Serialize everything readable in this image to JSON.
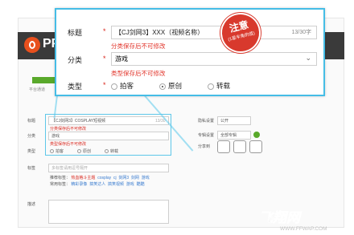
{
  "app": {
    "logo_text": "PP"
  },
  "progress": {
    "value_fraction": 0.2,
    "label": "平台通道"
  },
  "form": {
    "title_label": "标题",
    "title_value": "【CJ剑网3】COSPLAY短视频",
    "title_count": "13/30",
    "category_label": "分类",
    "category_note": "分类保存后不可修改",
    "category_value": "游戏",
    "type_label": "类型",
    "type_note": "类型保存后不可修改",
    "type_options": [
      "拍客",
      "原创",
      "转载"
    ],
    "tags_label": "标签",
    "tags_placeholder": "多标签请用逗号隔开",
    "recommended_label": "推荐标签：",
    "recommended_tags": [
      "热血格斗主题",
      "cosplay",
      "cj",
      "剑网3",
      "剑网",
      "游戏"
    ],
    "common_label": "常用标签：",
    "common_tags": [
      "精彩录像",
      "搞笑达人",
      "搞笑视频",
      "游戏",
      "酷酷"
    ],
    "desc_label": "描述"
  },
  "right_panel": {
    "privacy_label": "隐私设置",
    "privacy_value": "公开",
    "album_label": "专辑设置",
    "album_value": "全部专辑",
    "share_label": "分享到"
  },
  "popup": {
    "title_label": "标题",
    "title_value": "【CJ剑网3】XXX（视频名称）",
    "title_count": "13/30字",
    "category_note": "分类保存后不可修改",
    "category_label": "分类",
    "category_value": "游戏",
    "type_note": "类型保存后不可修改",
    "type_label": "类型",
    "type_options": [
      "拍客",
      "原创",
      "转载"
    ],
    "type_selected": "原创",
    "required_mark": "*"
  },
  "stamp": {
    "main": "注意",
    "sub": "(1星半角的值)"
  },
  "watermark": {
    "text": "飞翔网",
    "url": "WWW.FFWAP.COM"
  },
  "colors": {
    "accent": "#45bde6",
    "required": "#d9261c",
    "stamp": "#d8392d",
    "progress": "#59a92b"
  }
}
